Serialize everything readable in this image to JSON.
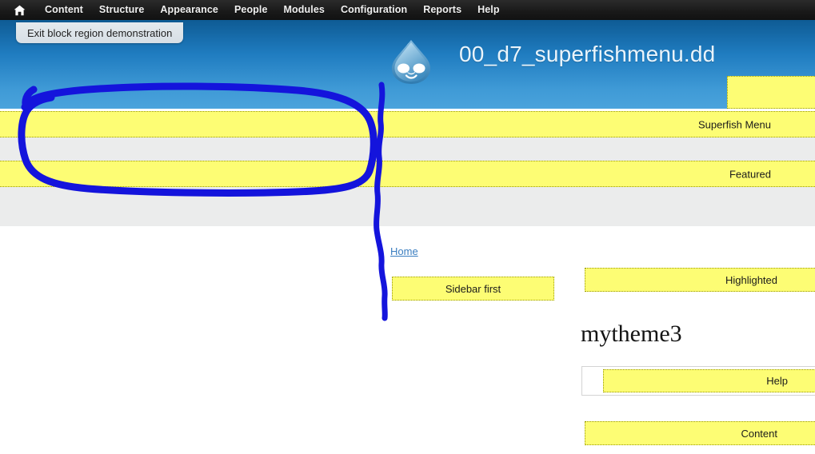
{
  "toolbar": {
    "home_icon": "home-icon",
    "items": [
      {
        "label": "Content"
      },
      {
        "label": "Structure"
      },
      {
        "label": "Appearance"
      },
      {
        "label": "People"
      },
      {
        "label": "Modules"
      },
      {
        "label": "Configuration"
      },
      {
        "label": "Reports"
      },
      {
        "label": "Help"
      }
    ]
  },
  "exit_tab": {
    "label": "Exit block region demonstration"
  },
  "header": {
    "site_title": "00_d7_superfishmenu.dd",
    "logo_icon": "drupal-droplet-logo",
    "header_block_label": ""
  },
  "regions": {
    "superfish_menu": "Superfish Menu",
    "featured": "Featured",
    "highlighted": "Highlighted",
    "help": "Help",
    "content": "Content",
    "sidebar_first": "Sidebar first"
  },
  "main": {
    "breadcrumb_home": "Home",
    "theme_name": "mytheme3"
  },
  "colors": {
    "region_fill": "#fdfd74",
    "region_border": "#9a9a00",
    "header_blue": "#2f8cc8",
    "band_gray": "#ebecec",
    "toolbar_dark": "#1a1a1a",
    "link_blue": "#3b7ec0",
    "annotation_blue": "#1414dc"
  }
}
